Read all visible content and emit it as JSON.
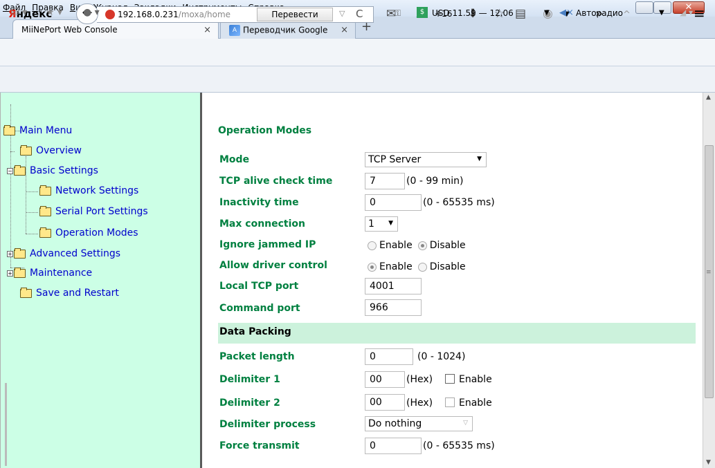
{
  "menubar": {
    "items": [
      "Файл",
      "Правка",
      "Вид",
      "Журнал",
      "Закладки",
      "Инструменты",
      "Справка"
    ],
    "close": "✕"
  },
  "tabs": [
    {
      "label": "MiiNePort Web Console",
      "close": "×"
    },
    {
      "label": "Переводчик Google",
      "close": "×"
    }
  ],
  "newtab": "+",
  "nav": {
    "brand": "Яндекс",
    "back": "←",
    "url_host": "192.168.0.231",
    "url_path": "/moxa/home",
    "translate": "Перевести",
    "url_drop": "▽",
    "reload": "C",
    "temperature": "+16",
    "more": "»",
    "up": "^",
    "menu": "≡"
  },
  "bookmarks": {
    "usd": "USD 11.59 — 12.06",
    "radio": "Авторадио",
    "dd": "▼"
  },
  "tree": {
    "root": "Main Menu",
    "overview": "Overview",
    "basic": "Basic Settings",
    "network": "Network Settings",
    "serial": "Serial Port Settings",
    "operation": "Operation Modes",
    "advanced": "Advanced Settings",
    "maintenance": "Maintenance",
    "save": "Save and Restart"
  },
  "form": {
    "title": "Operation Modes",
    "mode_label": "Mode",
    "mode_value": "TCP Server",
    "alive_label": "TCP alive check time",
    "alive_value": "7",
    "alive_hint": "(0 - 99 min)",
    "inactivity_label": "Inactivity time",
    "inactivity_value": "0",
    "inactivity_hint": "(0 - 65535 ms)",
    "maxconn_label": "Max connection",
    "maxconn_value": "1",
    "jammed_label": "Ignore jammed IP",
    "allow_label": "Allow driver control",
    "enable": "Enable",
    "disable": "Disable",
    "localport_label": "Local TCP port",
    "localport_value": "4001",
    "cmdport_label": "Command port",
    "cmdport_value": "966",
    "packing_header": "Data Packing",
    "packet_label": "Packet length",
    "packet_value": "0",
    "packet_hint": "(0 - 1024)",
    "delim1_label": "Delimiter 1",
    "delim1_value": "00",
    "delim2_label": "Delimiter 2",
    "delim2_value": "00",
    "hex": "(Hex)",
    "delimproc_label": "Delimiter process",
    "delimproc_value": "Do nothing",
    "force_label": "Force transmit",
    "force_value": "0",
    "force_hint": "(0 - 65535 ms)"
  }
}
